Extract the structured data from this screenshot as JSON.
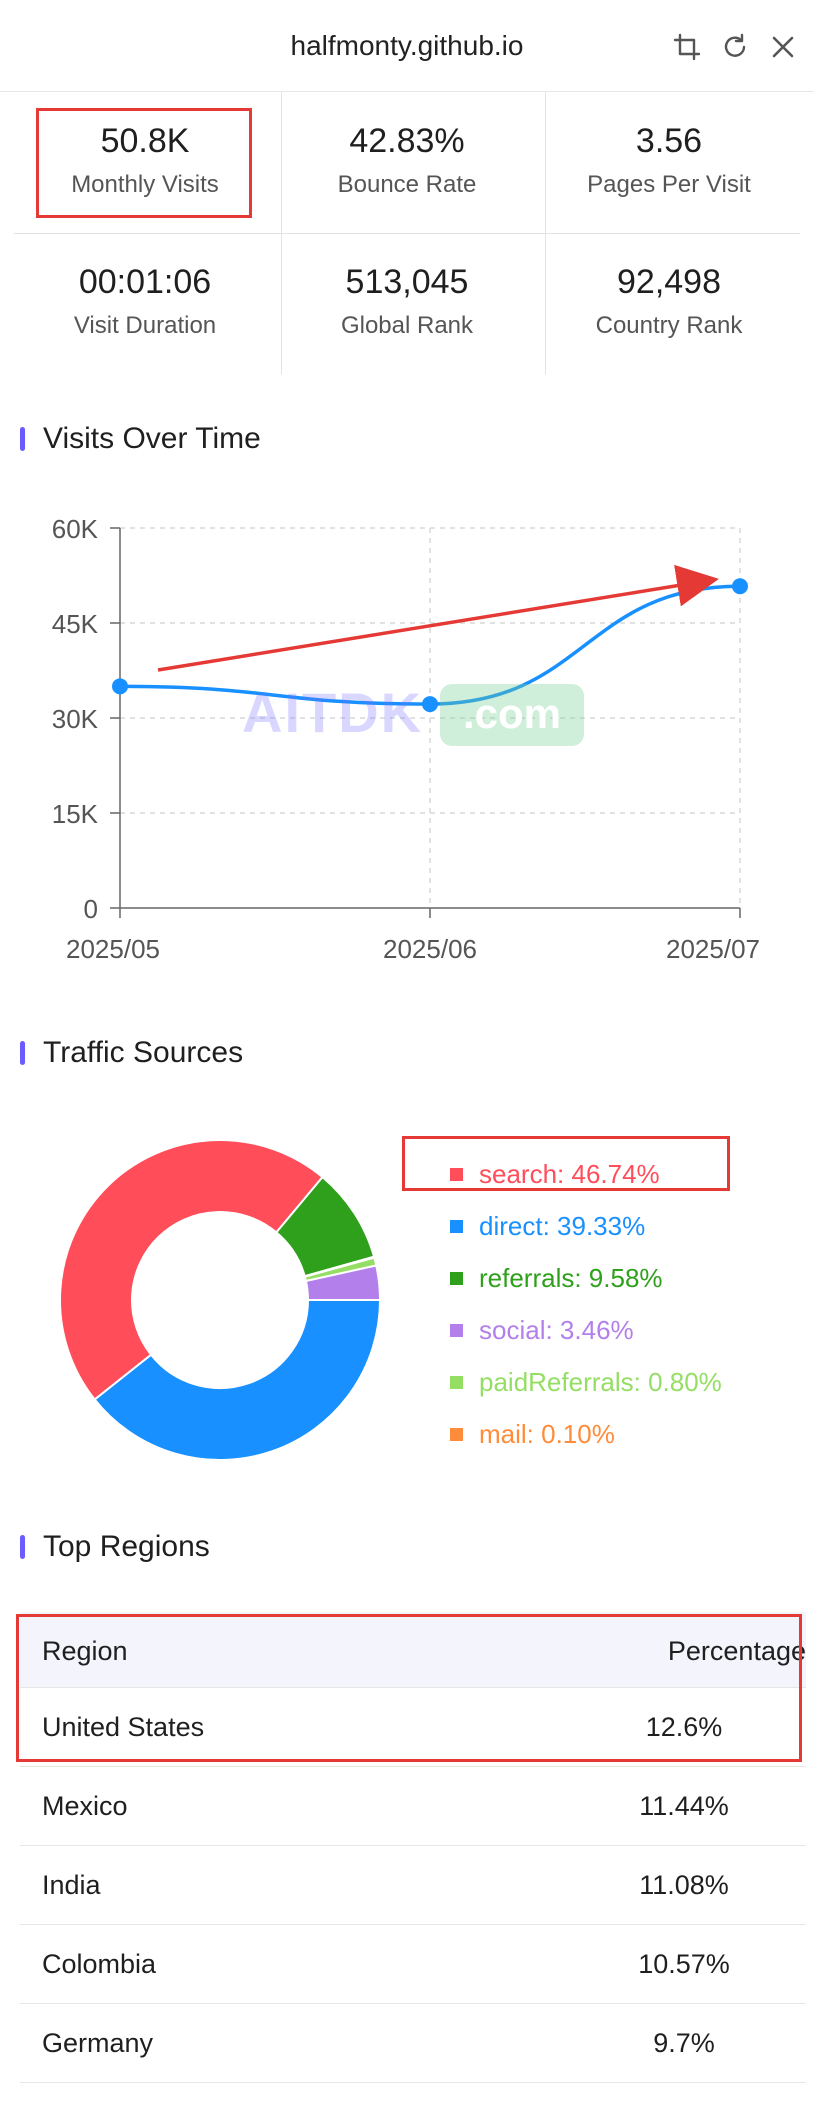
{
  "header": {
    "title": "halfmonty.github.io",
    "icons": [
      "crop-icon",
      "refresh-icon",
      "close-icon"
    ]
  },
  "stats": [
    {
      "value": "50.8K",
      "label": "Monthly Visits"
    },
    {
      "value": "42.83%",
      "label": "Bounce Rate"
    },
    {
      "value": "3.56",
      "label": "Pages Per Visit"
    },
    {
      "value": "00:01:06",
      "label": "Visit Duration"
    },
    {
      "value": "513,045",
      "label": "Global Rank"
    },
    {
      "value": "92,498",
      "label": "Country Rank"
    }
  ],
  "sections": {
    "visits": "Visits Over Time",
    "traffic": "Traffic Sources",
    "regions": "Top Regions"
  },
  "watermark": {
    "text": "AITDK",
    "pill": ".com"
  },
  "chart_data": [
    {
      "type": "line",
      "title": "Visits Over Time",
      "x": [
        "2025/05",
        "2025/06",
        "2025/07"
      ],
      "series": [
        {
          "values": [
            35000,
            32200,
            50800
          ],
          "color": "#1890ff"
        }
      ],
      "yticks": [
        "60K",
        "45K",
        "30K",
        "15K",
        "0"
      ],
      "ylim": [
        0,
        60000
      ],
      "grid": true,
      "annotation": {
        "type": "arrow",
        "color": "#e53935"
      }
    },
    {
      "type": "pie",
      "title": "Traffic Sources",
      "slices": [
        {
          "label": "search",
          "value": 46.74,
          "color": "#ff4d5a"
        },
        {
          "label": "direct",
          "value": 39.33,
          "color": "#1890ff"
        },
        {
          "label": "referrals",
          "value": 9.58,
          "color": "#2fa01c"
        },
        {
          "label": "social",
          "value": 3.46,
          "color": "#b37feb"
        },
        {
          "label": "paidReferrals",
          "value": 0.8,
          "color": "#95de64"
        },
        {
          "label": "mail",
          "value": 0.1,
          "color": "#ff8c3a"
        }
      ],
      "legend_text": [
        "search: 46.74%",
        "direct: 39.33%",
        "referrals: 9.58%",
        "social: 3.46%",
        "paidReferrals: 0.80%",
        "mail: 0.10%"
      ]
    }
  ],
  "regions": {
    "headers": {
      "region": "Region",
      "percentage": "Percentage"
    },
    "rows": [
      {
        "region": "United States",
        "percentage": "12.6%"
      },
      {
        "region": "Mexico",
        "percentage": "11.44%"
      },
      {
        "region": "India",
        "percentage": "11.08%"
      },
      {
        "region": "Colombia",
        "percentage": "10.57%"
      },
      {
        "region": "Germany",
        "percentage": "9.7%"
      }
    ]
  }
}
